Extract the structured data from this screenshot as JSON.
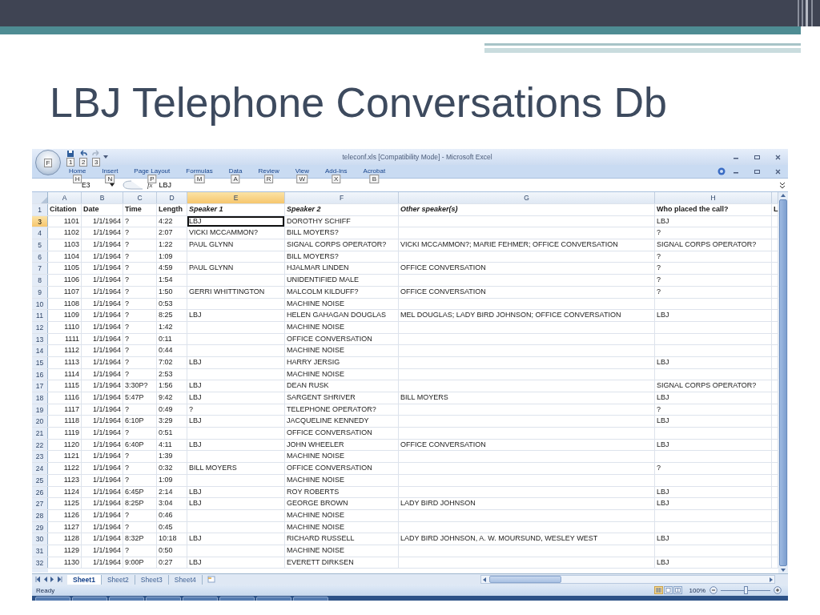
{
  "slide_title": "LBJ Telephone Conversations Db",
  "window": {
    "title": "teleconf.xls [Compatibility Mode] - Microsoft Excel"
  },
  "office_button": {
    "keytip": "F"
  },
  "quick_access": [
    {
      "kind": "save",
      "keytip": "1",
      "disabled": false
    },
    {
      "kind": "undo",
      "keytip": "2",
      "disabled": false
    },
    {
      "kind": "redo",
      "keytip": "3",
      "disabled": true
    }
  ],
  "ribbon_tabs": [
    {
      "label": "Home",
      "keytip": "H"
    },
    {
      "label": "Insert",
      "keytip": "N"
    },
    {
      "label": "Page Layout",
      "keytip": "P"
    },
    {
      "label": "Formulas",
      "keytip": "M"
    },
    {
      "label": "Data",
      "keytip": "A"
    },
    {
      "label": "Review",
      "keytip": "R"
    },
    {
      "label": "View",
      "keytip": "W"
    },
    {
      "label": "Add-Ins",
      "keytip": "X"
    },
    {
      "label": "Acrobat",
      "keytip": "B"
    }
  ],
  "formula_bar": {
    "name_box": "E3",
    "function_label": "fx",
    "value": "LBJ"
  },
  "columns": [
    {
      "letter": "A",
      "heading": "Citation",
      "italic": false,
      "numeric": true,
      "selected": false
    },
    {
      "letter": "B",
      "heading": "Date",
      "italic": false,
      "numeric": true,
      "selected": false
    },
    {
      "letter": "C",
      "heading": "Time",
      "italic": false,
      "numeric": false,
      "selected": false
    },
    {
      "letter": "D",
      "heading": "Length",
      "italic": false,
      "numeric": false,
      "selected": false
    },
    {
      "letter": "E",
      "heading": "Speaker 1",
      "italic": true,
      "numeric": false,
      "selected": true
    },
    {
      "letter": "F",
      "heading": "Speaker 2",
      "italic": true,
      "numeric": false,
      "selected": false
    },
    {
      "letter": "G",
      "heading": "Other speaker(s)",
      "italic": true,
      "numeric": false,
      "selected": false
    },
    {
      "letter": "H",
      "heading": "Who placed the call?",
      "italic": false,
      "numeric": false,
      "selected": false
    },
    {
      "heading": "L",
      "italic": false,
      "selected": false
    }
  ],
  "heading_row": {
    "number": "1",
    "selected": false
  },
  "rows": [
    {
      "number": "3",
      "selected": true,
      "cells": {
        "citation": "1101",
        "date": "1/1/1964",
        "time": "?",
        "length": "4:22",
        "speaker_1": "LBJ",
        "speaker_2": "DOROTHY SCHIFF",
        "placed_by": "LBJ"
      }
    },
    {
      "number": "4",
      "selected": false,
      "cells": {
        "citation": "1102",
        "date": "1/1/1964",
        "time": "?",
        "length": "2:07",
        "speaker_1": "VICKI MCCAMMON?",
        "speaker_2": "BILL MOYERS?",
        "placed_by": "?"
      }
    },
    {
      "number": "5",
      "selected": false,
      "cells": {
        "citation": "1103",
        "date": "1/1/1964",
        "time": "?",
        "length": "1:22",
        "speaker_1": "PAUL GLYNN",
        "speaker_2": "SIGNAL CORPS OPERATOR?",
        "other_speakers": "VICKI MCCAMMON?; MARIE FEHMER; OFFICE CONVERSATION",
        "placed_by": "SIGNAL CORPS OPERATOR?"
      }
    },
    {
      "number": "6",
      "selected": false,
      "cells": {
        "citation": "1104",
        "date": "1/1/1964",
        "time": "?",
        "length": "1:09",
        "speaker_2": "BILL MOYERS?",
        "placed_by": "?"
      }
    },
    {
      "number": "7",
      "selected": false,
      "cells": {
        "citation": "1105",
        "date": "1/1/1964",
        "time": "?",
        "length": "4:59",
        "speaker_1": "PAUL GLYNN",
        "speaker_2": "HJALMAR LINDEN",
        "other_speakers": "OFFICE CONVERSATION",
        "placed_by": "?"
      }
    },
    {
      "number": "8",
      "selected": false,
      "cells": {
        "citation": "1106",
        "date": "1/1/1964",
        "time": "?",
        "length": "1:54",
        "speaker_2": "UNIDENTIFIED MALE",
        "placed_by": "?"
      }
    },
    {
      "number": "9",
      "selected": false,
      "cells": {
        "citation": "1107",
        "date": "1/1/1964",
        "time": "?",
        "length": "1:50",
        "speaker_1": "GERRI WHITTINGTON",
        "speaker_2": "MALCOLM KILDUFF?",
        "other_speakers": "OFFICE CONVERSATION",
        "placed_by": "?"
      }
    },
    {
      "number": "10",
      "selected": false,
      "cells": {
        "citation": "1108",
        "date": "1/1/1964",
        "time": "?",
        "length": "0:53",
        "speaker_2": "MACHINE NOISE"
      }
    },
    {
      "number": "11",
      "selected": false,
      "cells": {
        "citation": "1109",
        "date": "1/1/1964",
        "time": "?",
        "length": "8:25",
        "speaker_1": "LBJ",
        "speaker_2": "HELEN GAHAGAN DOUGLAS",
        "other_speakers": "MEL DOUGLAS; LADY BIRD JOHNSON; OFFICE CONVERSATION",
        "placed_by": "LBJ"
      }
    },
    {
      "number": "12",
      "selected": false,
      "cells": {
        "citation": "1110",
        "date": "1/1/1964",
        "time": "?",
        "length": "1:42",
        "speaker_2": "MACHINE NOISE"
      }
    },
    {
      "number": "13",
      "selected": false,
      "cells": {
        "citation": "1111",
        "date": "1/1/1964",
        "time": "?",
        "length": "0:11",
        "speaker_2": "OFFICE CONVERSATION"
      }
    },
    {
      "number": "14",
      "selected": false,
      "cells": {
        "citation": "1112",
        "date": "1/1/1964",
        "time": "?",
        "length": "0:44",
        "speaker_2": "MACHINE NOISE"
      }
    },
    {
      "number": "15",
      "selected": false,
      "cells": {
        "citation": "1113",
        "date": "1/1/1964",
        "time": "?",
        "length": "7:02",
        "speaker_1": "LBJ",
        "speaker_2": "HARRY JERSIG",
        "placed_by": "LBJ"
      }
    },
    {
      "number": "16",
      "selected": false,
      "cells": {
        "citation": "1114",
        "date": "1/1/1964",
        "time": "?",
        "length": "2:53",
        "speaker_2": "MACHINE NOISE"
      }
    },
    {
      "number": "17",
      "selected": false,
      "cells": {
        "citation": "1115",
        "date": "1/1/1964",
        "time": "3:30P?",
        "length": "1:56",
        "speaker_1": "LBJ",
        "speaker_2": "DEAN RUSK",
        "placed_by": "SIGNAL CORPS OPERATOR?"
      }
    },
    {
      "number": "18",
      "selected": false,
      "cells": {
        "citation": "1116",
        "date": "1/1/1964",
        "time": "5:47P",
        "length": "9:42",
        "speaker_1": "LBJ",
        "speaker_2": "SARGENT SHRIVER",
        "other_speakers": "BILL MOYERS",
        "placed_by": "LBJ"
      }
    },
    {
      "number": "19",
      "selected": false,
      "cells": {
        "citation": "1117",
        "date": "1/1/1964",
        "time": "?",
        "length": "0:49",
        "speaker_1": "?",
        "speaker_2": "TELEPHONE OPERATOR?",
        "placed_by": "?"
      }
    },
    {
      "number": "20",
      "selected": false,
      "cells": {
        "citation": "1118",
        "date": "1/1/1964",
        "time": "6:10P",
        "length": "3:29",
        "speaker_1": "LBJ",
        "speaker_2": "JACQUELINE KENNEDY",
        "placed_by": "LBJ"
      }
    },
    {
      "number": "21",
      "selected": false,
      "cells": {
        "citation": "1119",
        "date": "1/1/1964",
        "time": "?",
        "length": "0:51",
        "speaker_2": "OFFICE CONVERSATION"
      }
    },
    {
      "number": "22",
      "selected": false,
      "cells": {
        "citation": "1120",
        "date": "1/1/1964",
        "time": "6:40P",
        "length": "4:11",
        "speaker_1": "LBJ",
        "speaker_2": "JOHN WHEELER",
        "other_speakers": "OFFICE CONVERSATION",
        "placed_by": "LBJ"
      }
    },
    {
      "number": "23",
      "selected": false,
      "cells": {
        "citation": "1121",
        "date": "1/1/1964",
        "time": "?",
        "length": "1:39",
        "speaker_2": "MACHINE NOISE"
      }
    },
    {
      "number": "24",
      "selected": false,
      "cells": {
        "citation": "1122",
        "date": "1/1/1964",
        "time": "?",
        "length": "0:32",
        "speaker_1": "BILL MOYERS",
        "speaker_2": "OFFICE CONVERSATION",
        "placed_by": "?"
      }
    },
    {
      "number": "25",
      "selected": false,
      "cells": {
        "citation": "1123",
        "date": "1/1/1964",
        "time": "?",
        "length": "1:09",
        "speaker_2": "MACHINE NOISE"
      }
    },
    {
      "number": "26",
      "selected": false,
      "cells": {
        "citation": "1124",
        "date": "1/1/1964",
        "time": "6:45P",
        "length": "2:14",
        "speaker_1": "LBJ",
        "speaker_2": "ROY ROBERTS",
        "placed_by": "LBJ"
      }
    },
    {
      "number": "27",
      "selected": false,
      "cells": {
        "citation": "1125",
        "date": "1/1/1964",
        "time": "8:25P",
        "length": "3:04",
        "speaker_1": "LBJ",
        "speaker_2": "GEORGE BROWN",
        "other_speakers": "LADY BIRD JOHNSON",
        "placed_by": "LBJ"
      }
    },
    {
      "number": "28",
      "selected": false,
      "cells": {
        "citation": "1126",
        "date": "1/1/1964",
        "time": "?",
        "length": "0:46",
        "speaker_2": "MACHINE NOISE"
      }
    },
    {
      "number": "29",
      "selected": false,
      "cells": {
        "citation": "1127",
        "date": "1/1/1964",
        "time": "?",
        "length": "0:45",
        "speaker_2": "MACHINE NOISE"
      }
    },
    {
      "number": "30",
      "selected": false,
      "cells": {
        "citation": "1128",
        "date": "1/1/1964",
        "time": "8:32P",
        "length": "10:18",
        "speaker_1": "LBJ",
        "speaker_2": "RICHARD RUSSELL",
        "other_speakers": "LADY BIRD JOHNSON, A. W. MOURSUND, WESLEY WEST",
        "placed_by": "LBJ"
      }
    },
    {
      "number": "31",
      "selected": false,
      "cells": {
        "citation": "1129",
        "date": "1/1/1964",
        "time": "?",
        "length": "0:50",
        "speaker_2": "MACHINE NOISE"
      }
    },
    {
      "number": "32",
      "selected": false,
      "cells": {
        "citation": "1130",
        "date": "1/1/1964",
        "time": "9:00P",
        "length": "0:27",
        "speaker_1": "LBJ",
        "speaker_2": "EVERETT DIRKSEN",
        "placed_by": "LBJ"
      }
    }
  ],
  "sheet_tabs": [
    {
      "label": "Sheet1",
      "selected": true
    },
    {
      "label": "Sheet2",
      "selected": false
    },
    {
      "label": "Sheet3",
      "selected": false
    },
    {
      "label": "Sheet4",
      "selected": false
    }
  ],
  "status_bar": {
    "status": "Ready",
    "zoom": "100%",
    "zoom_slider": {
      "level": 0.5
    },
    "views": [
      {
        "kind": "normal",
        "selected": true
      },
      {
        "kind": "page_layout",
        "selected": false
      },
      {
        "kind": "page_break",
        "selected": false
      }
    ]
  }
}
